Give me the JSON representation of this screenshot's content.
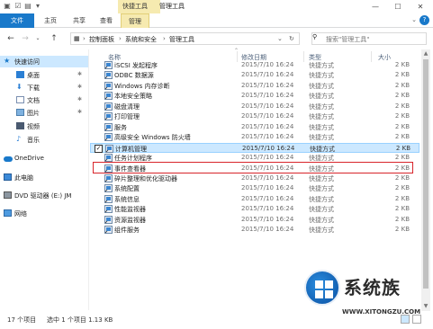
{
  "window": {
    "context_tab_group": "快捷工具",
    "title": "管理工具",
    "controls": [
      "minimize-icon",
      "maximize-icon",
      "close-icon"
    ]
  },
  "ribbon": {
    "tabs": [
      {
        "label": "文件"
      },
      {
        "label": "主页"
      },
      {
        "label": "共享"
      },
      {
        "label": "查看"
      },
      {
        "label": "管理"
      }
    ]
  },
  "address": {
    "crumbs": [
      "控制面板",
      "系统和安全",
      "管理工具"
    ],
    "search_placeholder": "搜索\"管理工具\""
  },
  "navpane": {
    "items": [
      {
        "label": "快速访问",
        "icon": "star-icon"
      },
      {
        "label": "桌面",
        "icon": "desktop-icon",
        "pinned": true
      },
      {
        "label": "下载",
        "icon": "download-icon",
        "pinned": true
      },
      {
        "label": "文档",
        "icon": "document-icon",
        "pinned": true
      },
      {
        "label": "图片",
        "icon": "picture-icon",
        "pinned": true
      },
      {
        "label": "视频",
        "icon": "video-icon"
      },
      {
        "label": "音乐",
        "icon": "music-icon"
      },
      {
        "label": "OneDrive",
        "icon": "cloud-icon"
      },
      {
        "label": "此电脑",
        "icon": "computer-icon"
      },
      {
        "label": "DVD 驱动器 (E:) JM",
        "icon": "dvd-icon"
      },
      {
        "label": "网络",
        "icon": "network-icon"
      }
    ]
  },
  "filelist": {
    "columns": {
      "name": "名称",
      "date": "修改日期",
      "type": "类型",
      "size": "大小"
    },
    "rows": [
      {
        "name": "iSCSI 发起程序",
        "date": "2015/7/10 16:24",
        "type": "快捷方式",
        "size": "2 KB"
      },
      {
        "name": "ODBC 数据源",
        "date": "2015/7/10 16:24",
        "type": "快捷方式",
        "size": "2 KB"
      },
      {
        "name": "Windows 内存诊断",
        "date": "2015/7/10 16:24",
        "type": "快捷方式",
        "size": "2 KB"
      },
      {
        "name": "本地安全策略",
        "date": "2015/7/10 16:24",
        "type": "快捷方式",
        "size": "2 KB"
      },
      {
        "name": "磁盘清理",
        "date": "2015/7/10 16:24",
        "type": "快捷方式",
        "size": "2 KB"
      },
      {
        "name": "打印管理",
        "date": "2015/7/10 16:24",
        "type": "快捷方式",
        "size": "2 KB"
      },
      {
        "name": "服务",
        "date": "2015/7/10 16:24",
        "type": "快捷方式",
        "size": "2 KB"
      },
      {
        "name": "高级安全 Windows 防火墙",
        "date": "2015/7/10 16:24",
        "type": "快捷方式",
        "size": "2 KB"
      },
      {
        "name": "计算机管理",
        "date": "2015/7/10 16:24",
        "type": "快捷方式",
        "size": "2 KB",
        "selected": true
      },
      {
        "name": "任务计划程序",
        "date": "2015/7/10 16:24",
        "type": "快捷方式",
        "size": "2 KB"
      },
      {
        "name": "事件查看器",
        "date": "2015/7/10 16:24",
        "type": "快捷方式",
        "size": "2 KB"
      },
      {
        "name": "碎片整理和优化驱动器",
        "date": "2015/7/10 16:24",
        "type": "快捷方式",
        "size": "2 KB"
      },
      {
        "name": "系统配置",
        "date": "2015/7/10 16:24",
        "type": "快捷方式",
        "size": "2 KB"
      },
      {
        "name": "系统信息",
        "date": "2015/7/10 16:24",
        "type": "快捷方式",
        "size": "2 KB"
      },
      {
        "name": "性能监视器",
        "date": "2015/7/10 16:24",
        "type": "快捷方式",
        "size": "2 KB"
      },
      {
        "name": "资源监视器",
        "date": "2015/7/10 16:24",
        "type": "快捷方式",
        "size": "2 KB"
      },
      {
        "name": "组件服务",
        "date": "2015/7/10 16:24",
        "type": "快捷方式",
        "size": "2 KB"
      }
    ]
  },
  "status": {
    "count": "17 个项目",
    "selection": "选中 1 个项目  1.13 KB"
  },
  "watermark": {
    "text": "系统族",
    "url": "WWW.XITONGZU.COM"
  },
  "colors": {
    "accent": "#1979ca",
    "selection": "#cce8ff",
    "context_tab": "#f6eab0",
    "highlight_border": "#d8242a"
  }
}
